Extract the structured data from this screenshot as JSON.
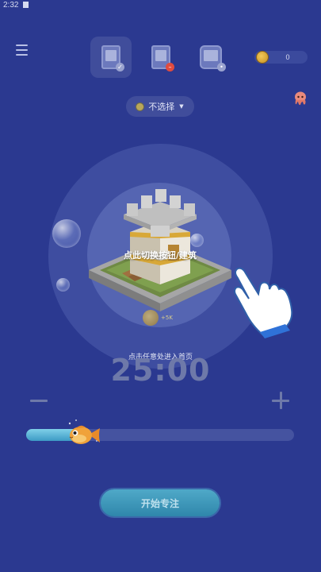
{
  "status_bar": {
    "time": "2:32"
  },
  "header": {
    "menu_icon": "menu-icon",
    "mode_tabs": [
      {
        "icon": "phone-focus-icon",
        "badge_color": "#9aa3cf",
        "active": true
      },
      {
        "icon": "phone-stop-icon",
        "badge_color": "#e04b3f",
        "active": false
      },
      {
        "icon": "phone-group-icon",
        "badge_color": "#9aa3cf",
        "active": false
      }
    ],
    "coins": {
      "icon": "coin-icon",
      "count": "0"
    },
    "octopus_icon": "octopus-icon"
  },
  "category": {
    "label": "不选择",
    "icon": "tag-dot-icon"
  },
  "building": {
    "icon": "castle-building-icon",
    "guide_text": "点此切换按钮/建筑",
    "reward_text": "+5K"
  },
  "hint": "点击任意处进入首页",
  "timer": {
    "value": "25:00"
  },
  "controls": {
    "minus_icon": "minus-icon",
    "plus_icon": "plus-icon"
  },
  "slider": {
    "level_fraction": 0.2,
    "handle_icon": "fish-icon"
  },
  "start_button": {
    "label": "开始专注"
  },
  "colors": {
    "background": "#2b3990",
    "accent": "#3d9bc5",
    "timer": "#6e79a9",
    "coin": "#e0b13a"
  }
}
